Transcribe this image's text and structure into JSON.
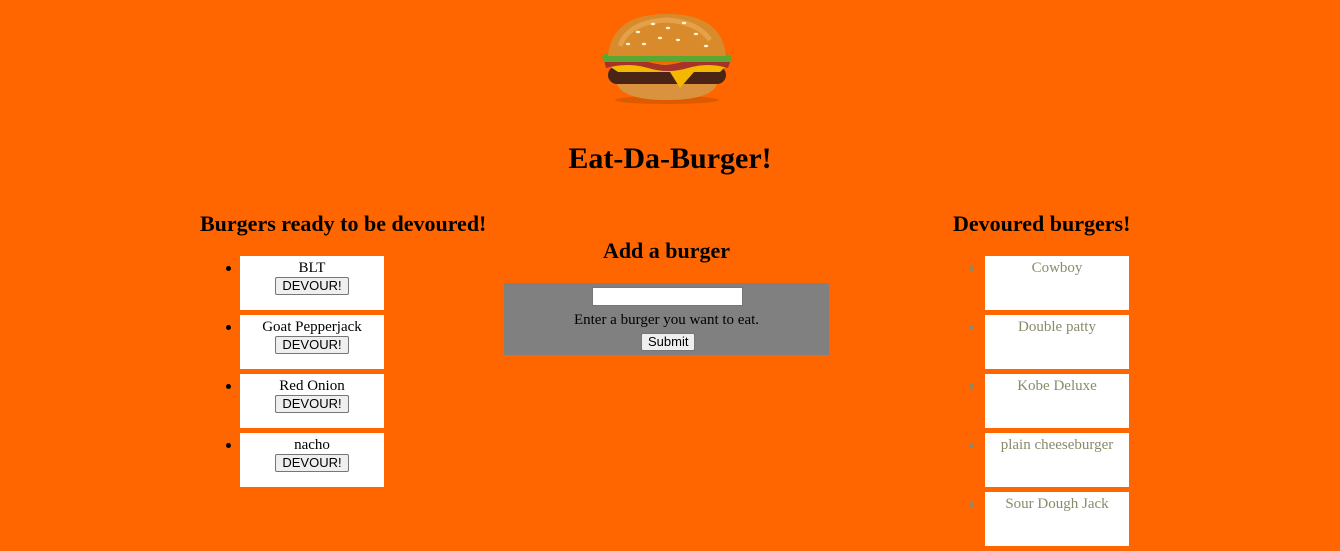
{
  "header": {
    "logo_icon": "burger-icon",
    "title": "Eat-Da-Burger!"
  },
  "ready": {
    "heading": "Burgers ready to be devoured!",
    "button_label": "DEVOUR!",
    "items": [
      {
        "name": "BLT"
      },
      {
        "name": "Goat Pepperjack"
      },
      {
        "name": "Red Onion"
      },
      {
        "name": "nacho"
      }
    ]
  },
  "add": {
    "heading": "Add a burger",
    "input_value": "",
    "hint": "Enter a burger you want to eat.",
    "submit_label": "Submit"
  },
  "devoured": {
    "heading": "Devoured burgers!",
    "items": [
      {
        "name": "Cowboy"
      },
      {
        "name": "Double patty"
      },
      {
        "name": "Kobe Deluxe"
      },
      {
        "name": "plain cheeseburger"
      },
      {
        "name": "Sour Dough Jack"
      }
    ]
  },
  "colors": {
    "background": "#ff6600",
    "panel": "#808080",
    "devoured_text": "#8a8a6a"
  }
}
